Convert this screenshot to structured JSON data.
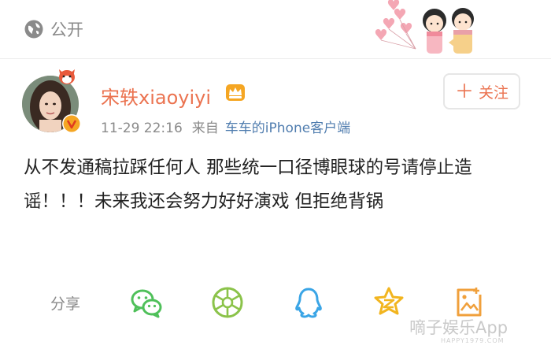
{
  "privacy": {
    "label": "公开",
    "icon": "globe-icon"
  },
  "post": {
    "username": "宋轶xiaoyiyi",
    "time": "11-29 22:16",
    "from_label": "来自",
    "source": "车车的iPhone客户端",
    "follow_label": "关注",
    "text": "从不发通稿拉踩任何人 那些统一口径博眼球的号请停止造谣！！！未来我还会努力好好演戏 但拒绝背锅"
  },
  "share": {
    "label": "分享",
    "icons": [
      "wechat-icon",
      "moments-icon",
      "qq-icon",
      "qzone-icon",
      "image-icon"
    ]
  },
  "watermark": {
    "text": "嘀子娱乐App",
    "sub": "HAPPY1979.COM"
  },
  "colors": {
    "accent": "#eb7350",
    "link": "#507daf",
    "gray": "#8a8a8a",
    "wechat": "#4fc05a",
    "moments": "#8bc34a",
    "qq": "#3aa5e6",
    "qzone": "#f2b51f",
    "image": "#f0a03c"
  }
}
